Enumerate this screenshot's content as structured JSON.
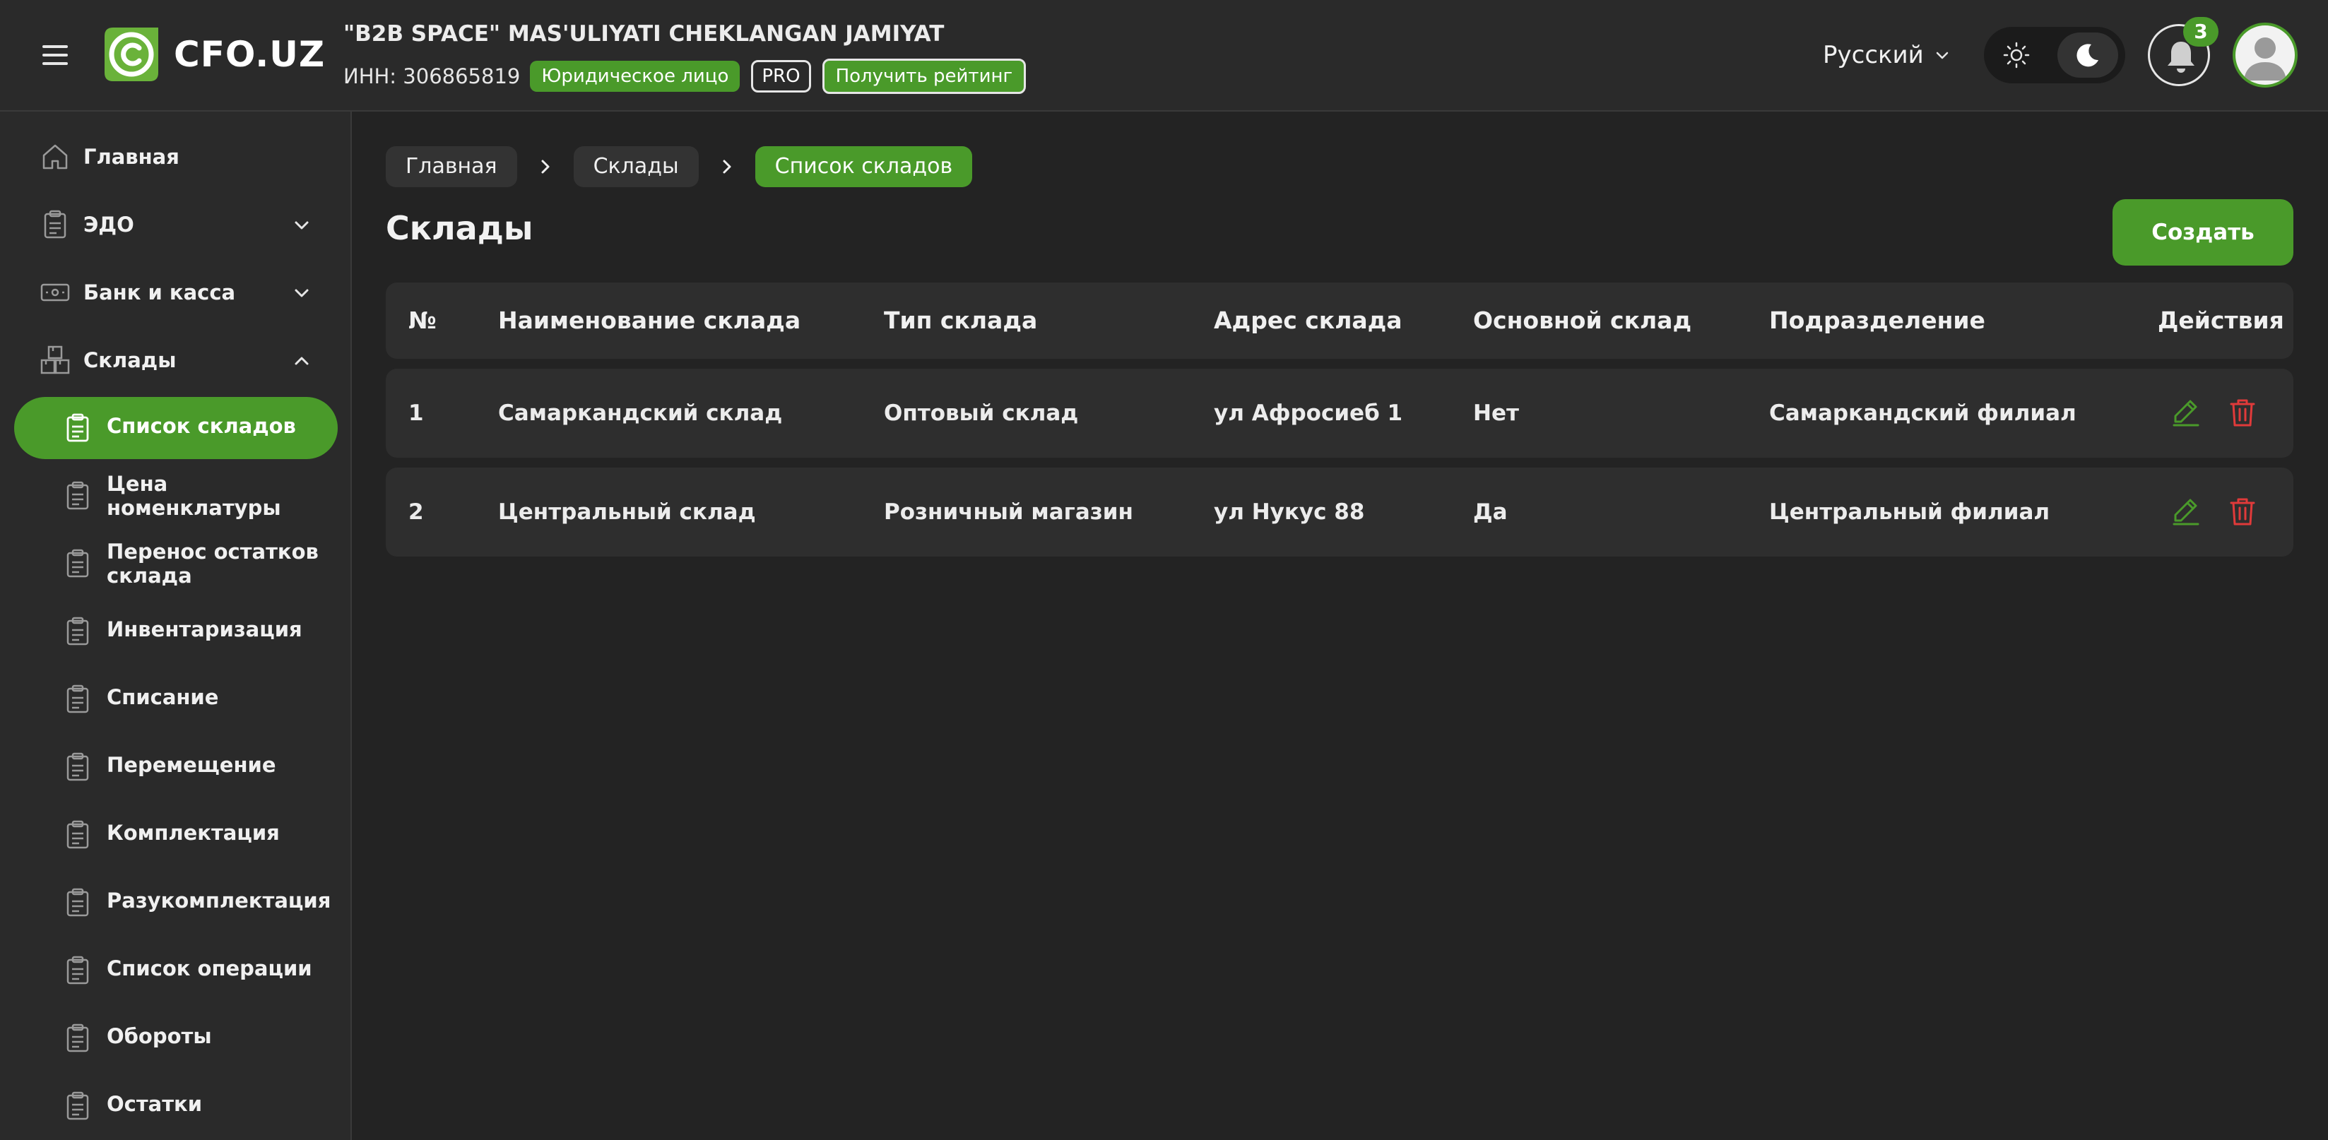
{
  "header": {
    "logo_text": "CFO.UZ",
    "company_name": "\"B2B SPACE\" MAS'ULIYATI CHEKLANGAN JAMIYAT",
    "inn": "ИНН: 306865819",
    "badge_entity": "Юридическое лицо",
    "badge_pro": "PRO",
    "rating_button": "Получить рейтинг",
    "language": "Русский",
    "notification_count": "3"
  },
  "sidebar": {
    "items": [
      {
        "label": "Главная",
        "icon": "home-icon"
      },
      {
        "label": "ЭДО",
        "icon": "clipboard-icon"
      },
      {
        "label": "Банк и касса",
        "icon": "cash-icon"
      },
      {
        "label": "Склады",
        "icon": "boxes-icon"
      }
    ],
    "sub_items": [
      {
        "label": "Список складов",
        "active": true
      },
      {
        "label": "Цена номенклатуры"
      },
      {
        "label": "Перенос остатков склада"
      },
      {
        "label": "Инвентаризация"
      },
      {
        "label": "Списание"
      },
      {
        "label": "Перемещение"
      },
      {
        "label": "Комплектация"
      },
      {
        "label": "Разукомплектация"
      },
      {
        "label": "Список операции"
      },
      {
        "label": "Обороты"
      },
      {
        "label": "Остатки"
      }
    ]
  },
  "breadcrumb": [
    "Главная",
    "Склады",
    "Список складов"
  ],
  "page": {
    "title": "Склады",
    "create_button": "Создать"
  },
  "table": {
    "columns": [
      "№",
      "Наименование склада",
      "Тип склада",
      "Адрес склада",
      "Основной склад",
      "Подразделение",
      "Действия"
    ],
    "rows": [
      [
        "1",
        "Самаркандский склад",
        "Оптовый склад",
        "ул Афросиеб 1",
        "Нет",
        "Самаркандский филиал"
      ],
      [
        "2",
        "Центральный склад",
        "Розничный магазин",
        "ул Нукус 88",
        "Да",
        "Центральный филиал"
      ]
    ]
  },
  "colors": {
    "accent": "#4a9a2a",
    "background": "#232323",
    "panel": "#2a2a2a",
    "danger": "#e03a3a"
  }
}
